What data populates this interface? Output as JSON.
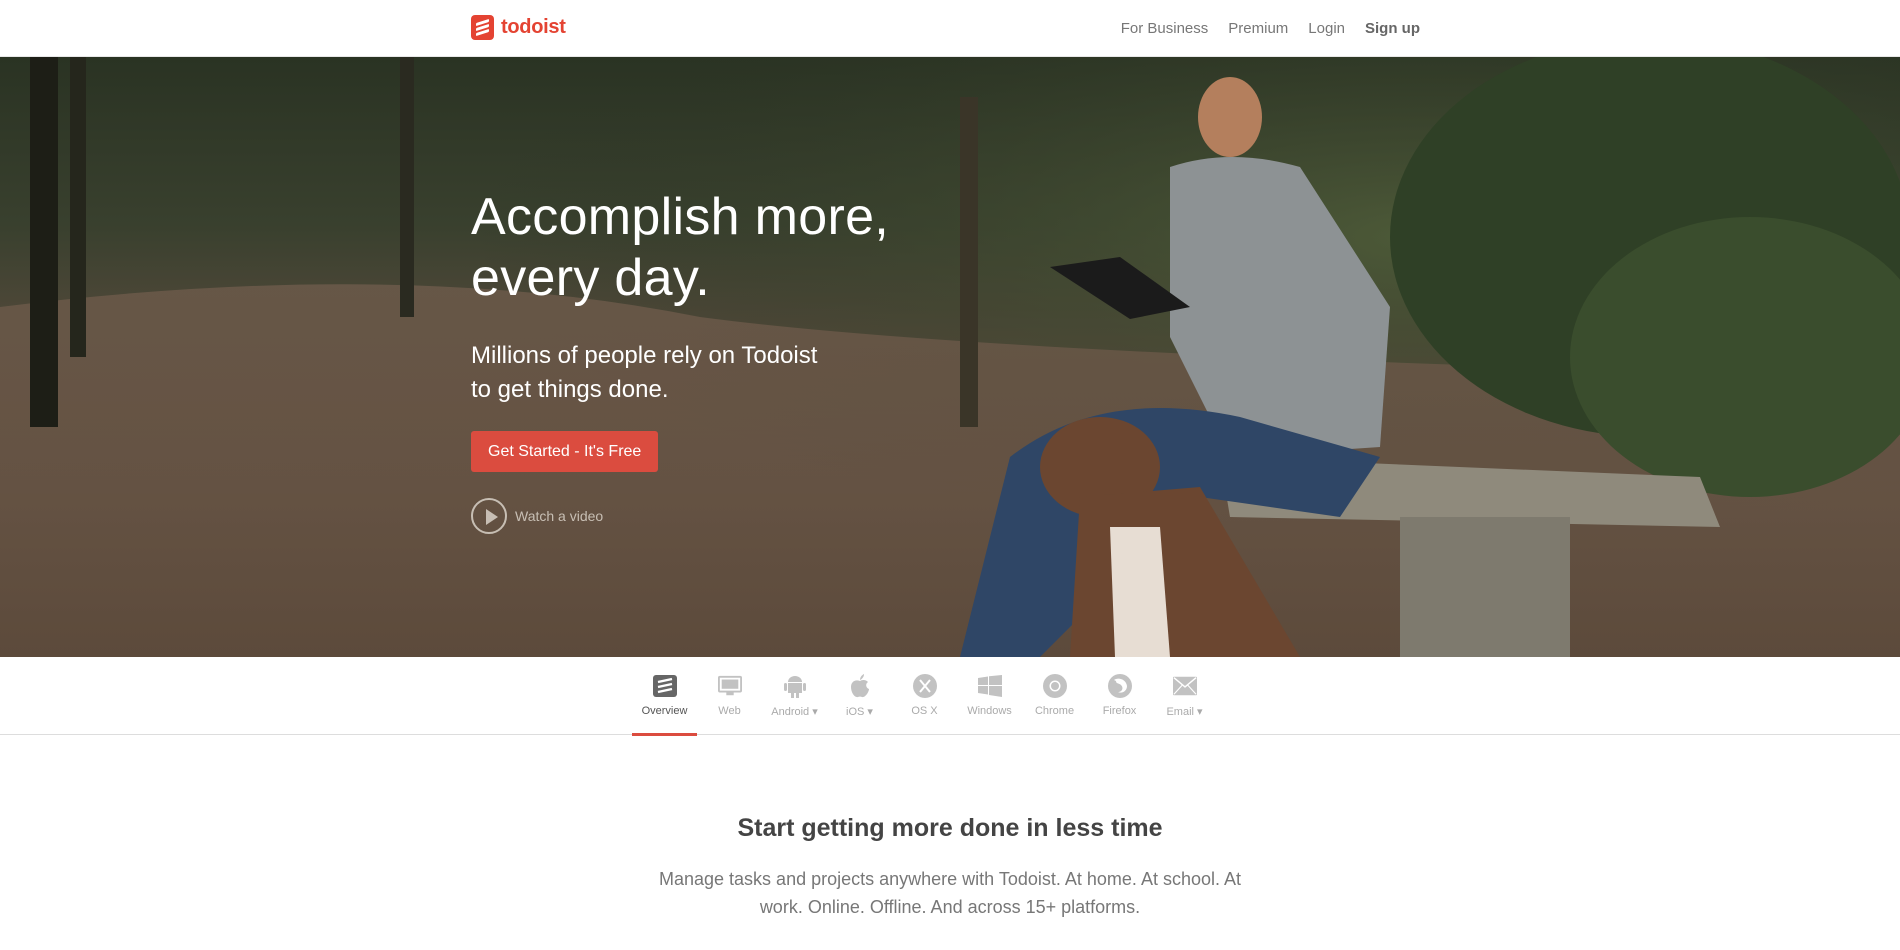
{
  "header": {
    "logo_text": "todoist",
    "nav": [
      {
        "label": "For Business"
      },
      {
        "label": "Premium"
      },
      {
        "label": "Login"
      },
      {
        "label": "Sign up"
      }
    ]
  },
  "hero": {
    "headline_line1": "Accomplish more,",
    "headline_line2": "every day.",
    "subline1": "Millions of people rely on Todoist",
    "subline2": "to get things done.",
    "cta_label": "Get Started - It's Free",
    "video_label": "Watch a video"
  },
  "platforms": {
    "tabs": [
      {
        "label": "Overview",
        "icon": "todoist-icon",
        "active": true
      },
      {
        "label": "Web",
        "icon": "monitor-icon"
      },
      {
        "label": "Android ▾",
        "icon": "android-icon"
      },
      {
        "label": "iOS ▾",
        "icon": "apple-icon"
      },
      {
        "label": "OS X",
        "icon": "osx-icon"
      },
      {
        "label": "Windows",
        "icon": "windows-icon"
      },
      {
        "label": "Chrome",
        "icon": "chrome-icon"
      },
      {
        "label": "Firefox",
        "icon": "firefox-icon"
      },
      {
        "label": "Email ▾",
        "icon": "email-icon"
      }
    ]
  },
  "main": {
    "title": "Start getting more done in less time",
    "text_line1": "Manage tasks and projects anywhere with Todoist. At home. At school. At",
    "text_line2": "work. Online. Offline. And across 15+ platforms."
  },
  "colors": {
    "brand": "#e44332",
    "cta": "#db4c3f"
  }
}
